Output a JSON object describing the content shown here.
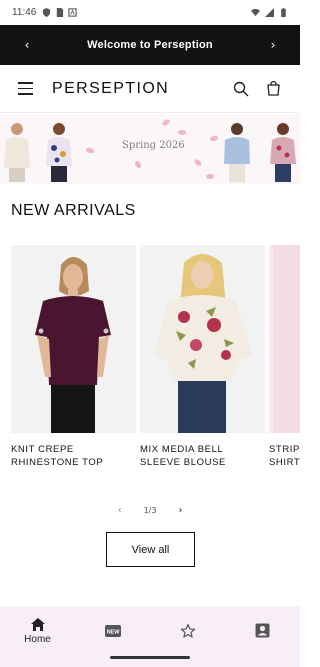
{
  "status_bar": {
    "time": "11:46"
  },
  "announcement": {
    "message": "Welcome to Perseption"
  },
  "header": {
    "logo": "PERSEPTION"
  },
  "banner": {
    "text": "Spring 2026"
  },
  "section": {
    "title": "NEW ARRIVALS"
  },
  "products": [
    {
      "name": "KNIT CREPE RHINESTONE TOP",
      "shirt_color": "#4a1530"
    },
    {
      "name": "MIX MEDIA BELL SLEEVE BLOUSE",
      "shirt_color": "#f3ece3"
    },
    {
      "name": "STRIPE SHIRT",
      "shirt_color": "#f6dde5"
    }
  ],
  "pager": {
    "text": "1/3"
  },
  "view_all": {
    "label": "View all"
  },
  "bottom_nav": {
    "home_label": "Home",
    "new_badge": "NEW"
  },
  "colors": {
    "announcement_bg": "#121212",
    "bottom_nav_bg": "#f7eef7",
    "banner_bg": "#fbf7f8"
  }
}
